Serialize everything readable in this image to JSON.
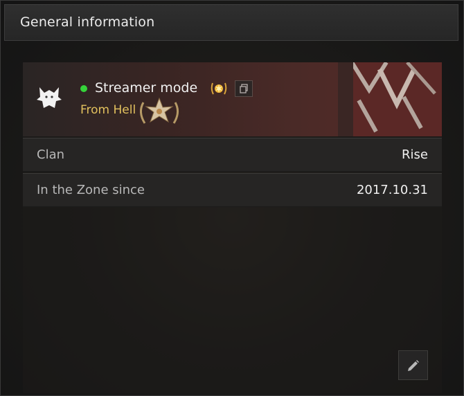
{
  "header": {
    "title": "General information"
  },
  "profile": {
    "username": "Streamer mode",
    "title": "From Hell",
    "status_color": "#35d33a",
    "title_color": "#e2c15e",
    "icons": {
      "avatar": "wolf-icon",
      "badge": "gold-flame-badge-icon",
      "copy": "copy-icon",
      "rank": "star-laurel-emblem-icon"
    }
  },
  "details": [
    {
      "label": "Clan",
      "value": "Rise"
    },
    {
      "label": "In the Zone since",
      "value": "2017.10.31"
    }
  ],
  "actions": {
    "edit_icon": "pencil-icon"
  }
}
